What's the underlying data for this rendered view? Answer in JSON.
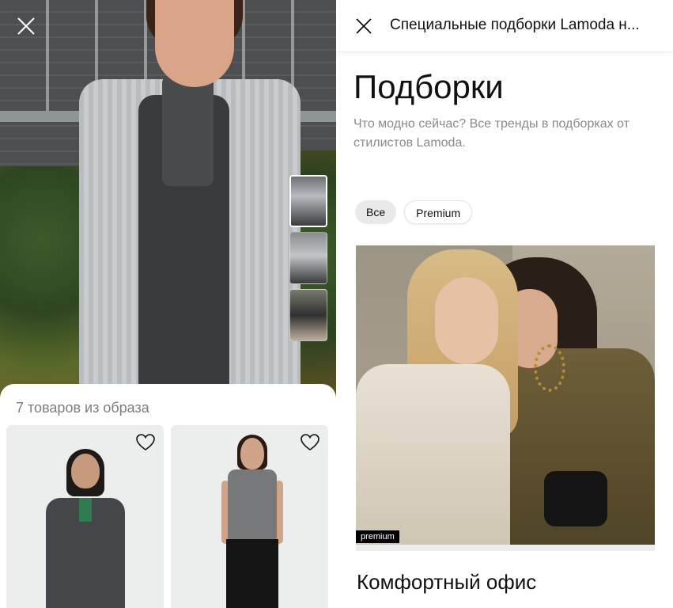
{
  "lookPanel": {
    "products_count_label": "7 товаров из образа",
    "products": [
      {
        "id": "blazer"
      },
      {
        "id": "tank"
      }
    ],
    "thumbnails": 3
  },
  "collectionsPanel": {
    "topbar_title": "Специальные подборки Lamoda н...",
    "page_title": "Подборки",
    "page_subtitle": "Что модно сейчас? Все тренды в подборках от стилистов Lamoda.",
    "filters": [
      {
        "label": "Все",
        "active": true
      },
      {
        "label": "Premium",
        "active": false
      }
    ],
    "featured": {
      "badge": "premium",
      "title": "Комфортный офис"
    }
  },
  "icons": {
    "close": "close-icon",
    "heart": "heart-icon"
  }
}
